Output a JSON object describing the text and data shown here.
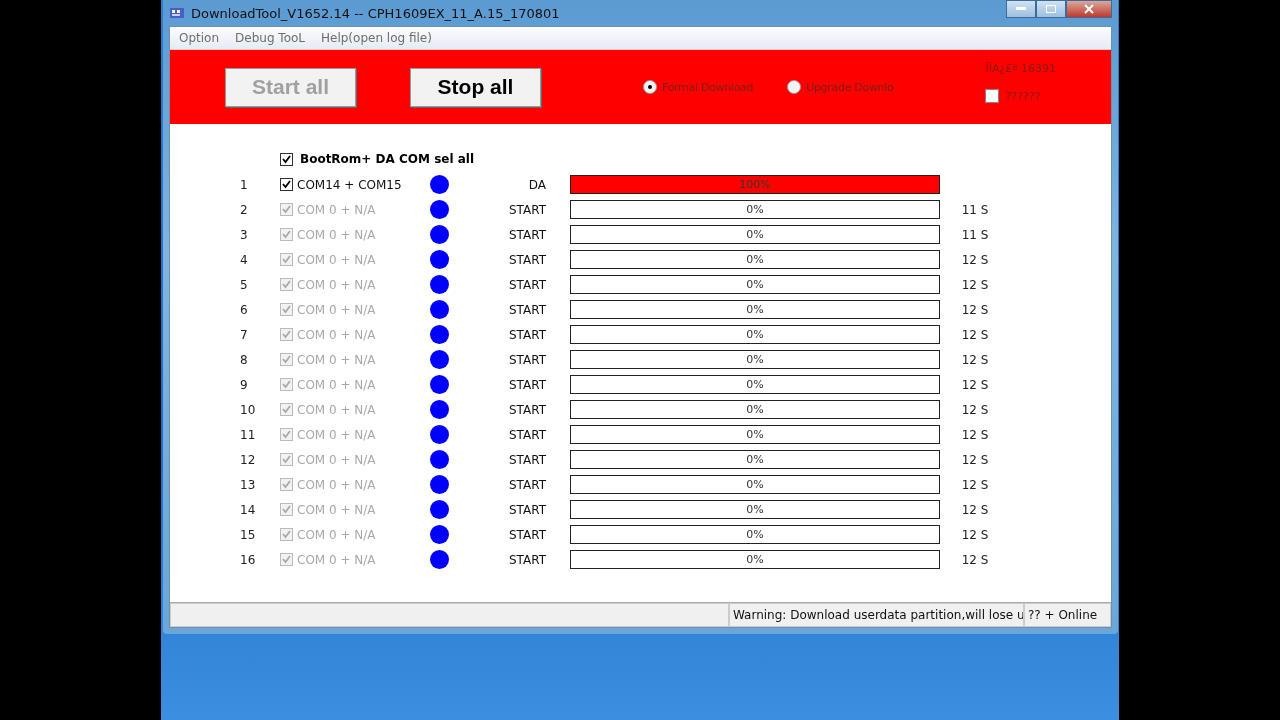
{
  "window": {
    "title": "DownloadTool_V1652.14 -- CPH1609EX_11_A.15_170801"
  },
  "menu": [
    "Option",
    "Debug TooL",
    "Help(open log file)"
  ],
  "toolbar": {
    "buttons": [
      {
        "label": "Start all",
        "disabled": true
      },
      {
        "label": "Stop all",
        "disabled": false
      }
    ],
    "modes": [
      {
        "label": "Formal Download",
        "selected": true
      },
      {
        "label": "Upgrade Downlo",
        "selected": false
      }
    ],
    "code": "ÎÍA¿£ª 16391",
    "option": {
      "label": "??????",
      "checked": false
    }
  },
  "select_all": {
    "label": "BootRom+ DA COM sel all",
    "checked": true
  },
  "ports": [
    {
      "index": "1",
      "port": "COM14 + COM15",
      "checked": true,
      "disabled": false,
      "stage": "DA",
      "level": 1,
      "percent": "100%"
    },
    {
      "index": "2",
      "port": "COM 0 + N/A",
      "checked": true,
      "disabled": true,
      "stage": "START",
      "level": 0,
      "percent": "0%",
      "time": "11 S"
    },
    {
      "index": "3",
      "port": "COM 0 + N/A",
      "checked": true,
      "disabled": true,
      "stage": "START",
      "level": 0,
      "percent": "0%",
      "time": "11 S"
    },
    {
      "index": "4",
      "port": "COM 0 + N/A",
      "checked": true,
      "disabled": true,
      "stage": "START",
      "level": 0,
      "percent": "0%",
      "time": "12 S"
    },
    {
      "index": "5",
      "port": "COM 0 + N/A",
      "checked": true,
      "disabled": true,
      "stage": "START",
      "level": 0,
      "percent": "0%",
      "time": "12 S"
    },
    {
      "index": "6",
      "port": "COM 0 + N/A",
      "checked": true,
      "disabled": true,
      "stage": "START",
      "level": 0,
      "percent": "0%",
      "time": "12 S"
    },
    {
      "index": "7",
      "port": "COM 0 + N/A",
      "checked": true,
      "disabled": true,
      "stage": "START",
      "level": 0,
      "percent": "0%",
      "time": "12 S"
    },
    {
      "index": "8",
      "port": "COM 0 + N/A",
      "checked": true,
      "disabled": true,
      "stage": "START",
      "level": 0,
      "percent": "0%",
      "time": "12 S"
    },
    {
      "index": "9",
      "port": "COM 0 + N/A",
      "checked": true,
      "disabled": true,
      "stage": "START",
      "level": 0,
      "percent": "0%",
      "time": "12 S"
    },
    {
      "index": "10",
      "port": "COM 0 + N/A",
      "checked": true,
      "disabled": true,
      "stage": "START",
      "level": 0,
      "percent": "0%",
      "time": "12 S"
    },
    {
      "index": "11",
      "port": "COM 0 + N/A",
      "checked": true,
      "disabled": true,
      "stage": "START",
      "level": 0,
      "percent": "0%",
      "time": "12 S"
    },
    {
      "index": "12",
      "port": "COM 0 + N/A",
      "checked": true,
      "disabled": true,
      "stage": "START",
      "level": 0,
      "percent": "0%",
      "time": "12 S"
    },
    {
      "index": "13",
      "port": "COM 0 + N/A",
      "checked": true,
      "disabled": true,
      "stage": "START",
      "level": 0,
      "percent": "0%",
      "time": "12 S"
    },
    {
      "index": "14",
      "port": "COM 0 + N/A",
      "checked": true,
      "disabled": true,
      "stage": "START",
      "level": 0,
      "percent": "0%",
      "time": "12 S"
    },
    {
      "index": "15",
      "port": "COM 0 + N/A",
      "checked": true,
      "disabled": true,
      "stage": "START",
      "level": 0,
      "percent": "0%",
      "time": "12 S"
    },
    {
      "index": "16",
      "port": "COM 0 + N/A",
      "checked": true,
      "disabled": true,
      "stage": "START",
      "level": 0,
      "percent": "0%",
      "time": "12 S"
    }
  ],
  "status_bar": [
    "Warning: Download userdata partition,will lose u",
    "?? + Online"
  ]
}
